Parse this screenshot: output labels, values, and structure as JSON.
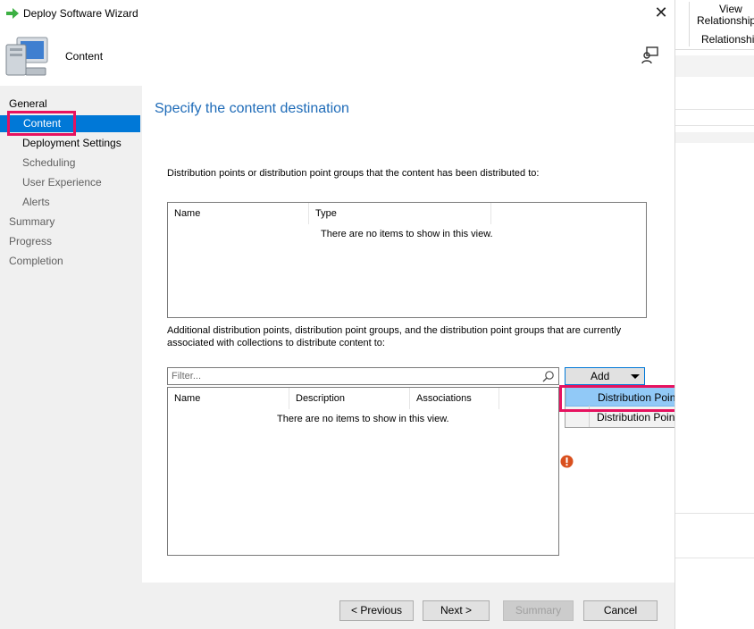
{
  "window": {
    "title": "Deploy Software Wizard",
    "page_name": "Content",
    "close_glyph": "✕"
  },
  "nav": {
    "items": [
      {
        "label": "General",
        "state": "header"
      },
      {
        "label": "Content",
        "state": "active"
      },
      {
        "label": "Deployment Settings",
        "state": "subitem"
      },
      {
        "label": "Scheduling",
        "state": "subitem"
      },
      {
        "label": "User Experience",
        "state": "subitem"
      },
      {
        "label": "Alerts",
        "state": "subitem"
      },
      {
        "label": "Summary",
        "state": "item"
      },
      {
        "label": "Progress",
        "state": "item"
      },
      {
        "label": "Completion",
        "state": "item"
      }
    ]
  },
  "main": {
    "heading": "Specify the content destination",
    "distributed_label": "Distribution points or distribution point groups that the content has been distributed to:",
    "list1": {
      "columns": [
        "Name",
        "Type"
      ],
      "empty_message": "There are no items to show in this view."
    },
    "additional_label_line1": "Additional distribution points, distribution point groups, and the distribution point groups that are currently",
    "additional_label_line2": "associated with collections to distribute content to:",
    "filter_placeholder": "Filter...",
    "list2": {
      "columns": [
        "Name",
        "Description",
        "Associations"
      ],
      "empty_message": "There are no items to show in this view."
    },
    "add_button": "Add",
    "add_menu": [
      "Distribution Point",
      "Distribution Point Group"
    ]
  },
  "footer": {
    "previous": "< Previous",
    "next": "Next >",
    "summary": "Summary",
    "cancel": "Cancel"
  },
  "background_console": {
    "ribbon_line1": "View",
    "ribbon_line2": "Relationship",
    "ribbon_line3": "Relationship"
  },
  "colors": {
    "active_nav": "#0078d7",
    "highlight_box": "#e6125f",
    "heading": "#1e6bb8",
    "menu_hover": "#91c9f7",
    "warning": "#d9501e"
  },
  "icons": [
    "green-arrow-icon",
    "computer-icon",
    "feedback-icon",
    "search-icon",
    "warning-icon",
    "dropdown-caret-icon",
    "close-icon"
  ]
}
